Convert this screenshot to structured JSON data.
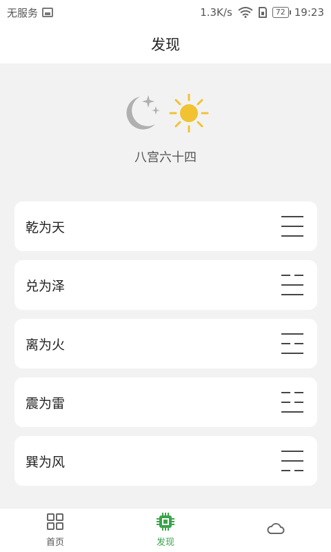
{
  "status_bar": {
    "carrier": "无服务",
    "speed": "1.3K/s",
    "battery": "72",
    "time": "19:23"
  },
  "nav": {
    "title": "发现"
  },
  "hero": {
    "title": "八宫六十四"
  },
  "palaces": [
    {
      "label": "乾为天",
      "lines": [
        "yang",
        "yang",
        "yang"
      ]
    },
    {
      "label": "兑为泽",
      "lines": [
        "yin",
        "yang",
        "yang"
      ]
    },
    {
      "label": "离为火",
      "lines": [
        "yang",
        "yin",
        "yang"
      ]
    },
    {
      "label": "震为雷",
      "lines": [
        "yin",
        "yin",
        "yang"
      ]
    },
    {
      "label": "巽为风",
      "lines": [
        "yang",
        "yang",
        "yin"
      ]
    }
  ],
  "tabs": [
    {
      "label": "首页",
      "icon": "grid-icon",
      "active": false
    },
    {
      "label": "发现",
      "icon": "chip-icon",
      "active": true
    },
    {
      "label": "",
      "icon": "cloud-icon",
      "active": false
    }
  ],
  "colors": {
    "accent": "#3aa34a",
    "sun": "#f1c232",
    "moon": "#b0b0b0"
  }
}
